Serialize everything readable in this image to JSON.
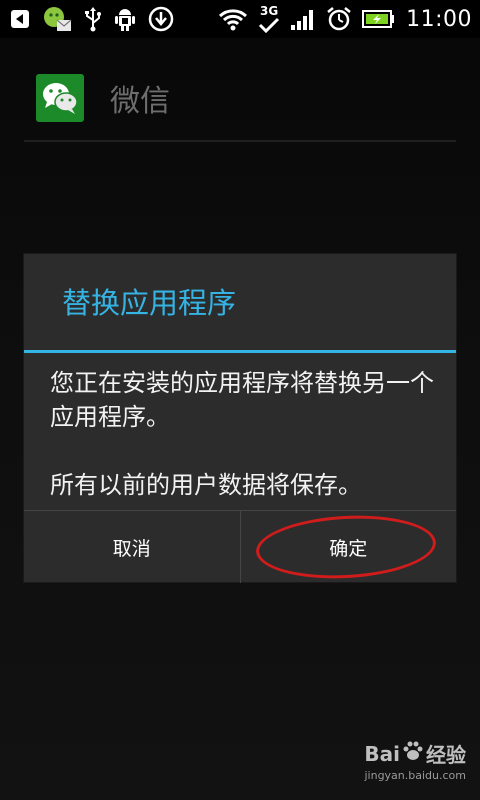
{
  "status_bar": {
    "time": "11:00",
    "network_label": "3G",
    "icons": [
      "back-arrow-icon",
      "wechat-notification-icon",
      "usb-icon",
      "android-debug-icon",
      "download-icon",
      "wifi-icon",
      "3g-icon",
      "signal-icon",
      "alarm-icon",
      "battery-charging-icon"
    ],
    "battery_color": "#7ed321"
  },
  "app": {
    "title": "微信",
    "icon_color": "#1d8a2a"
  },
  "dialog": {
    "title": "替换应用程序",
    "message": "您正在安装的应用程序将替换另一个应用程序。\n\n所有以前的用户数据将保存。",
    "cancel_label": "取消",
    "ok_label": "确定",
    "accent_color": "#33b5e5"
  },
  "annotation": {
    "highlight_color": "#d11c1c"
  },
  "watermark": {
    "brand": "Bai",
    "brand_suffix": "经验",
    "url": "jingyan.baidu.com"
  }
}
